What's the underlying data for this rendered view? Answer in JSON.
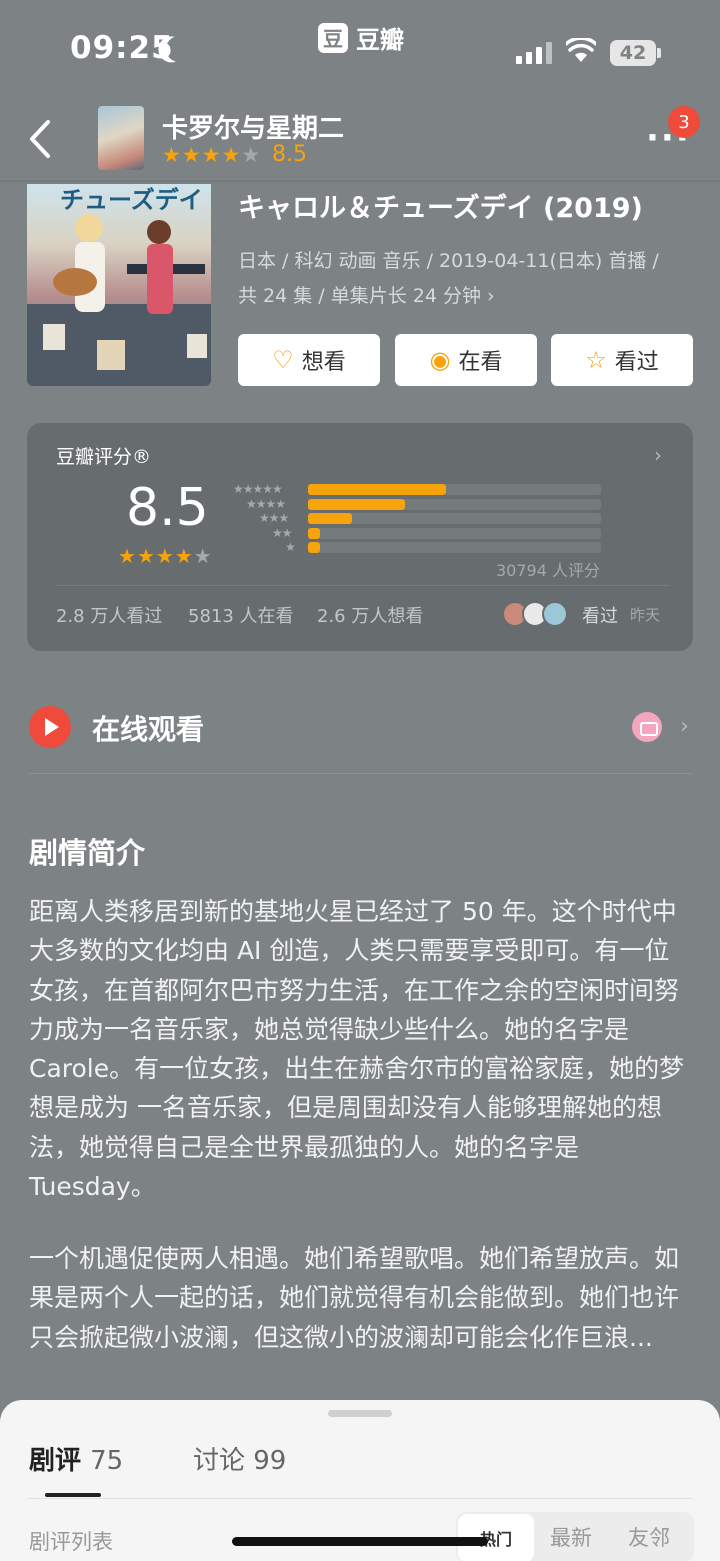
{
  "status": {
    "time": "09:25",
    "brand_logo": "豆",
    "brand_name": "豆瓣",
    "battery": "42"
  },
  "header": {
    "title": "卡罗尔与星期二",
    "score": "8.5",
    "notification_count": "3"
  },
  "hero": {
    "poster_text": "チューズデイ",
    "original_title": "キャロル＆チューズデイ (2019)",
    "meta_line1": "日本 / 科幻 动画 音乐 / 2019-04-11(日本) 首播 /",
    "meta_line2": "共 24 集 / 单集片长 24 分钟 ›",
    "actions": {
      "want": "想看",
      "watching": "在看",
      "watched": "看过"
    }
  },
  "rating": {
    "label": "豆瓣评分®",
    "score": "8.5",
    "stars_filled": 4,
    "distribution": [
      {
        "stars": 5,
        "fraction": 0.47
      },
      {
        "stars": 4,
        "fraction": 0.33
      },
      {
        "stars": 3,
        "fraction": 0.15
      },
      {
        "stars": 2,
        "fraction": 0.04
      },
      {
        "stars": 1,
        "fraction": 0.04
      }
    ],
    "count": "30794 人评分",
    "stats": {
      "watched": "2.8 万人看过",
      "watching": "5813 人在看",
      "want": "2.6 万人想看"
    },
    "friend_action": "看过",
    "friend_time": "昨天"
  },
  "online": {
    "label": "在线观看"
  },
  "synopsis": {
    "heading": "剧情简介",
    "paragraph1": "距离人类移居到新的基地火星已经过了 50 年。这个时代中大多数的文化均由 AI 创造，人类只需要享受即可。有一位女孩，在首都阿尔巴市努力生活，在工作之余的空闲时间努力成为一名音乐家，她总觉得缺少些什么。她的名字是 Carole。有一位女孩，出生在赫舍尔市的富裕家庭，她的梦想是成为 一名音乐家，但是周围却没有人能够理解她的想法，她觉得自己是全世界最孤独的人。她的名字是 Tuesday。",
    "paragraph2": "一个机遇促使两人相遇。她们希望歌唱。她们希望放声。如果是两个人一起的话，她们就觉得有机会能做到。她们也许只会掀起微小波澜，但这微小的波澜却可能会化作巨浪..."
  },
  "sheet": {
    "tab_reviews": "剧评",
    "tab_reviews_count": "75",
    "tab_discuss": "讨论 99",
    "list_label": "剧评列表",
    "sort_options": {
      "hot": "热门",
      "new": "最新",
      "friends": "友邻"
    }
  },
  "colors": {
    "accent": "#f7a30b",
    "background": "#7d8284",
    "play": "#ef4a3b",
    "badge": "#ee4b3b"
  }
}
